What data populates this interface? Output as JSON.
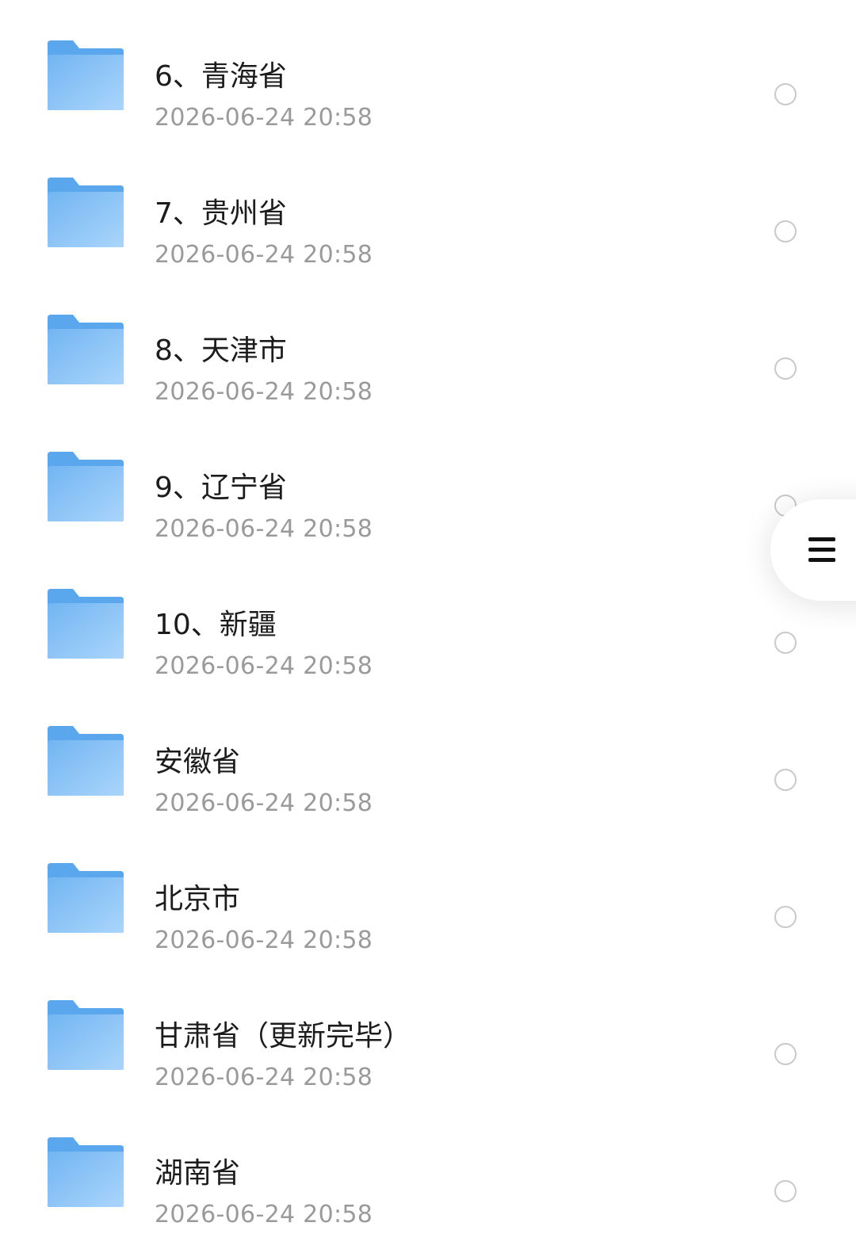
{
  "files": [
    {
      "name": "6、青海省",
      "date": "2026-06-24 20:58"
    },
    {
      "name": "7、贵州省",
      "date": "2026-06-24 20:58"
    },
    {
      "name": "8、天津市",
      "date": "2026-06-24 20:58"
    },
    {
      "name": "9、辽宁省",
      "date": "2026-06-24 20:58"
    },
    {
      "name": "10、新疆",
      "date": "2026-06-24 20:58"
    },
    {
      "name": "安徽省",
      "date": "2026-06-24 20:58"
    },
    {
      "name": "北京市",
      "date": "2026-06-24 20:58"
    },
    {
      "name": "甘肃省（更新完毕）",
      "date": "2026-06-24 20:58"
    },
    {
      "name": "湖南省",
      "date": "2026-06-24 20:58"
    }
  ],
  "icons": {
    "folder": "folder-icon",
    "select": "radio-unchecked-icon",
    "menu": "hamburger-menu-icon"
  },
  "colors": {
    "folder_back": "#5aa7ee",
    "folder_front_top": "#7cbaf3",
    "folder_front_bottom": "#a9d4fb",
    "name_text": "#1c1c1c",
    "date_text": "#9a9a9a",
    "radio_border": "#c9c9c9"
  }
}
